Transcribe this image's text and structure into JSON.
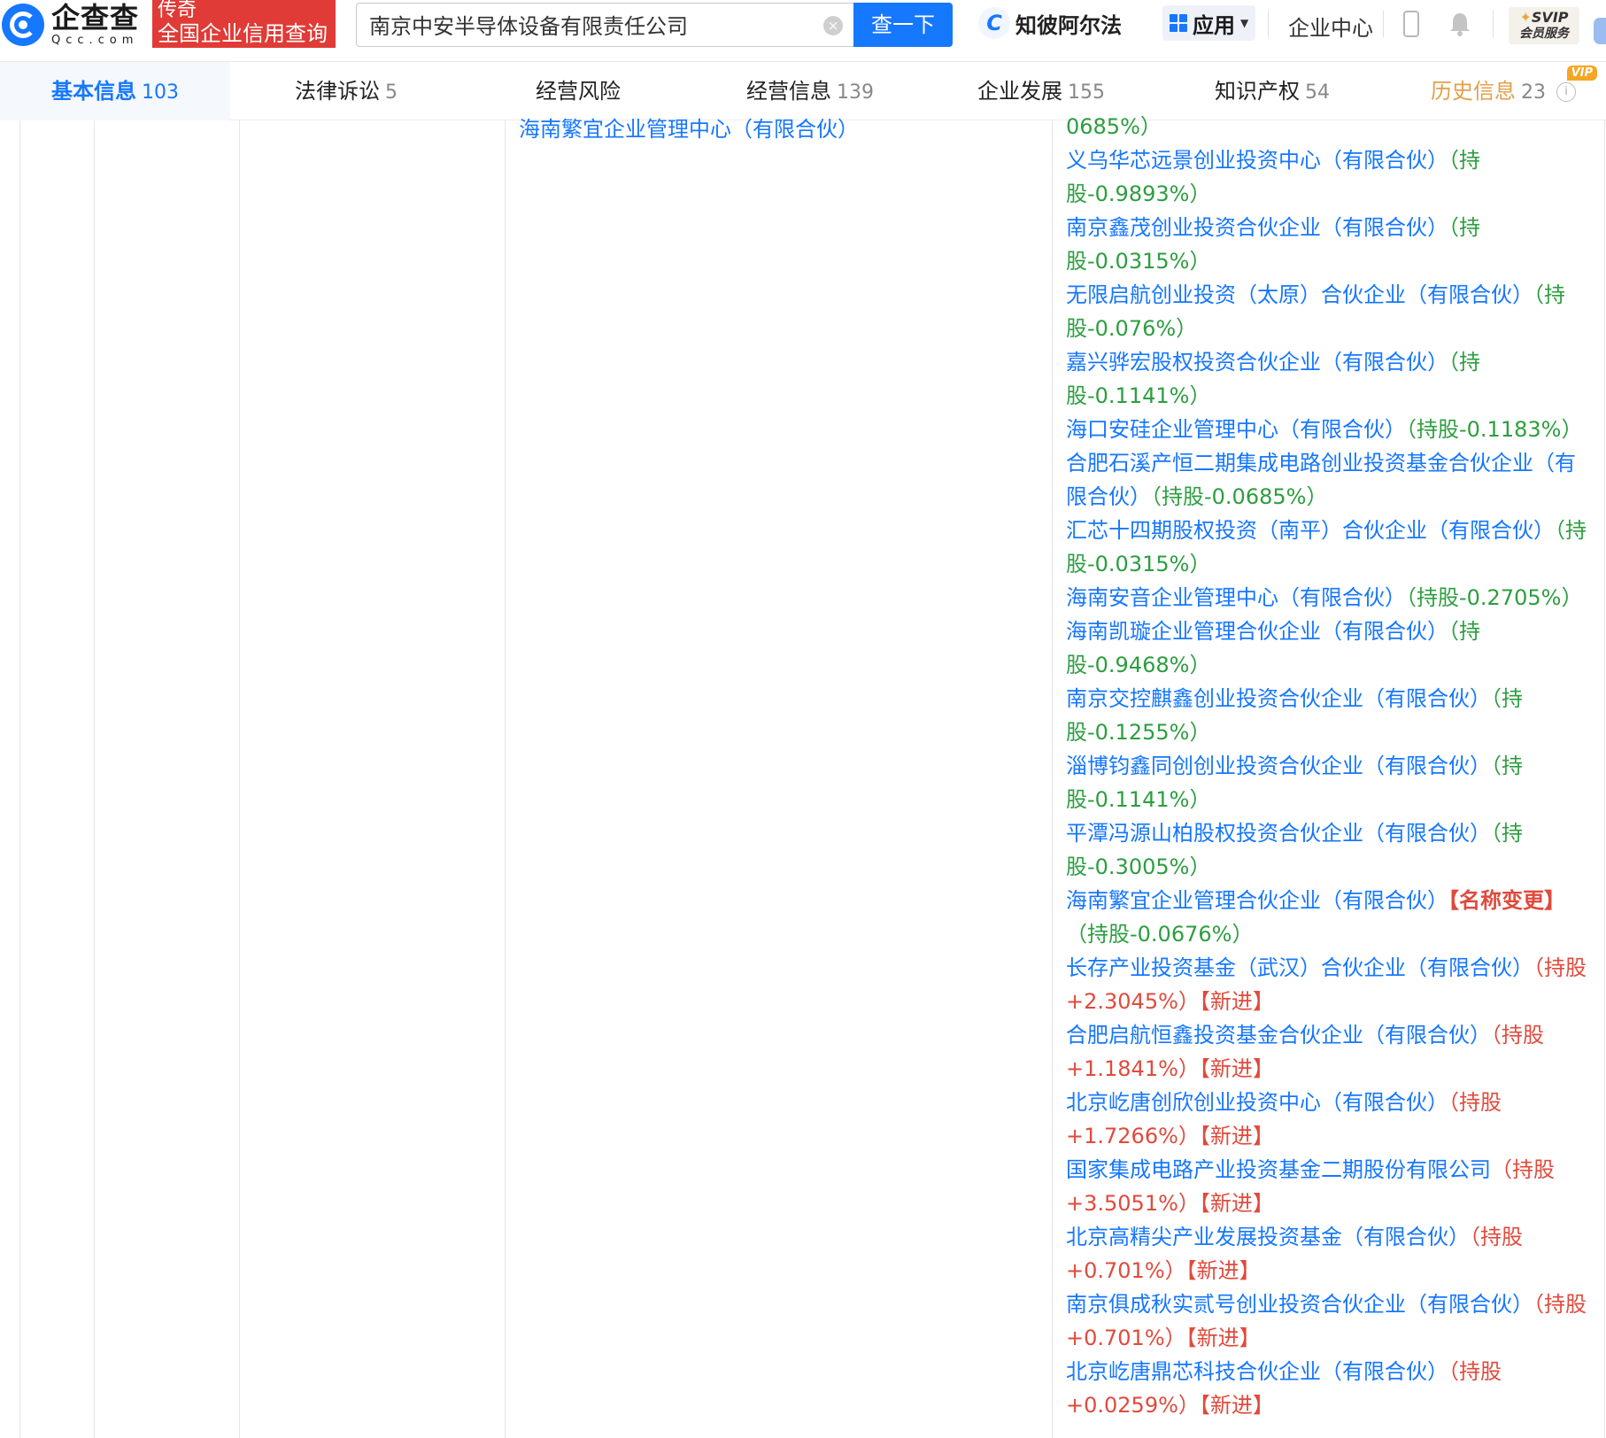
{
  "header": {
    "logo_name": "企查查",
    "logo_domain": "Qcc.com",
    "badge_line1": "传奇",
    "badge_line2": "全国企业信用查询",
    "search_value": "南京中安半导体设备有限责任公司",
    "clear_symbol": "×",
    "search_button": "查一下",
    "zhibi_icon_char": "C",
    "zhibi_label": "知彼阿尔法",
    "app_menu_label": "应用",
    "enterprise_center": "企业中心",
    "svip_line1": "SVIP",
    "svip_line2": "会员服务"
  },
  "tabs": [
    {
      "label": "基本信息",
      "count": "103"
    },
    {
      "label": "法律诉讼",
      "count": "5"
    },
    {
      "label": "经营风险",
      "count": ""
    },
    {
      "label": "经营信息",
      "count": "139"
    },
    {
      "label": "企业发展",
      "count": "155"
    },
    {
      "label": "知识产权",
      "count": "54"
    },
    {
      "label": "历史信息",
      "count": "23",
      "badge": "VIP"
    }
  ],
  "colors": {
    "brand_blue": "#1677ff",
    "share_decrease": "#2c9e3f",
    "share_increase": "#e04a3c",
    "badge_red": "#e03b36",
    "vip_orange": "#f5a623"
  },
  "table": {
    "prev_column_item": "海南繁宜企业管理中心（有限合伙）",
    "changes_top_fragment": "0685%）",
    "changes": [
      {
        "company": "义乌华芯远景创业投资中心（有限合伙）",
        "pct": "（持股-0.9893%）",
        "dir": "minus"
      },
      {
        "company": "南京鑫茂创业投资合伙企业（有限合伙）",
        "pct": "（持股-0.0315%）",
        "dir": "minus"
      },
      {
        "company": "无限启航创业投资（太原）合伙企业（有限合伙）",
        "pct": "（持股-0.076%）",
        "dir": "minus"
      },
      {
        "company": "嘉兴骅宏股权投资合伙企业（有限合伙）",
        "pct": "（持股-0.1141%）",
        "dir": "minus"
      },
      {
        "company": "海口安硅企业管理中心（有限合伙）",
        "pct": "（持股-0.1183%）",
        "dir": "minus"
      },
      {
        "company": "合肥石溪产恒二期集成电路创业投资基金合伙企业（有限合伙）",
        "pct": "（持股-0.0685%）",
        "dir": "minus"
      },
      {
        "company": "汇芯十四期股权投资（南平）合伙企业（有限合伙）",
        "pct": "（持股-0.0315%）",
        "dir": "minus"
      },
      {
        "company": "海南安音企业管理中心（有限合伙）",
        "pct": "（持股-0.2705%）",
        "dir": "minus"
      },
      {
        "company": "海南凯璇企业管理合伙企业（有限合伙）",
        "pct": "（持股-0.9468%）",
        "dir": "minus"
      },
      {
        "company": "南京交控麒鑫创业投资合伙企业（有限合伙）",
        "pct": "（持股-0.1255%）",
        "dir": "minus"
      },
      {
        "company": "淄博钧鑫同创创业投资合伙企业（有限合伙）",
        "pct": "（持股-0.1141%）",
        "dir": "minus"
      },
      {
        "company": "平潭冯源山柏股权投资合伙企业（有限合伙）",
        "pct": "（持股-0.3005%）",
        "dir": "minus"
      },
      {
        "company": "海南繁宜企业管理合伙企业（有限合伙）",
        "tag_before": "【名称变更】",
        "pct": "（持股-0.0676%）",
        "dir": "minus"
      },
      {
        "company": "长存产业投资基金（武汉）合伙企业（有限合伙）",
        "pct": "（持股+2.3045%）",
        "dir": "plus",
        "tag_after": "【新进】"
      },
      {
        "company": "合肥启航恒鑫投资基金合伙企业（有限合伙）",
        "pct": "（持股+1.1841%）",
        "dir": "plus",
        "tag_after": "【新进】"
      },
      {
        "company": "北京屹唐创欣创业投资中心（有限合伙）",
        "pct": "（持股+1.7266%）",
        "dir": "plus",
        "tag_after": "【新进】"
      },
      {
        "company": "国家集成电路产业投资基金二期股份有限公司",
        "pct": "（持股+3.5051%）",
        "dir": "plus",
        "tag_after": "【新进】"
      },
      {
        "company": "北京高精尖产业发展投资基金（有限合伙）",
        "pct": "（持股+0.701%）",
        "dir": "plus",
        "tag_after": "【新进】"
      },
      {
        "company": "南京俱成秋实贰号创业投资合伙企业（有限合伙）",
        "pct": "（持股+0.701%）",
        "dir": "plus",
        "tag_after": "【新进】"
      },
      {
        "company": "北京屹唐鼎芯科技合伙企业（有限合伙）",
        "pct": "（持股+0.0259%）",
        "dir": "plus",
        "tag_after": "【新进】"
      }
    ]
  }
}
